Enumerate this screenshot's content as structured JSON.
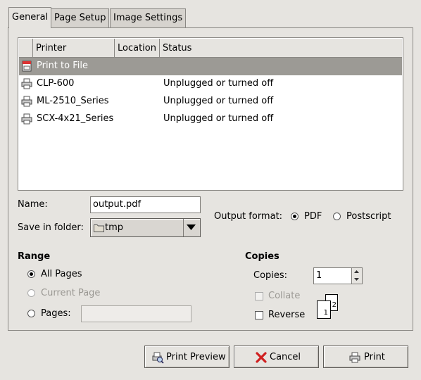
{
  "tabs": [
    {
      "label": "General",
      "active": true
    },
    {
      "label": "Page Setup"
    },
    {
      "label": "Image Settings"
    }
  ],
  "printer_list": {
    "columns": [
      "Printer",
      "Location",
      "Status"
    ],
    "rows": [
      {
        "name": "Print to File",
        "location": "",
        "status": "",
        "icon": "print-to-file-icon",
        "selected": true
      },
      {
        "name": "CLP-600",
        "location": "",
        "status": "Unplugged or turned off",
        "icon": "printer-icon"
      },
      {
        "name": "ML-2510_Series",
        "location": "",
        "status": "Unplugged or turned off",
        "icon": "printer-icon"
      },
      {
        "name": "SCX-4x21_Series",
        "location": "",
        "status": "Unplugged or turned off",
        "icon": "printer-icon"
      }
    ]
  },
  "file": {
    "name_label": "Name:",
    "name_value": "output.pdf",
    "folder_label": "Save in folder:",
    "folder_value": "tmp",
    "output_format_label": "Output format:",
    "format_pdf": "PDF",
    "format_ps": "Postscript",
    "selected_format": "PDF"
  },
  "range": {
    "heading": "Range",
    "all_pages": "All Pages",
    "current_page": "Current Page",
    "pages": "Pages:",
    "pages_value": ""
  },
  "copies": {
    "heading": "Copies",
    "copies_label": "Copies:",
    "copies_value": "1",
    "collate_label": "Collate",
    "reverse_label": "Reverse",
    "preview_page_front": "1",
    "preview_page_back": "2"
  },
  "buttons": {
    "preview": "Print Preview",
    "cancel": "Cancel",
    "print": "Print"
  }
}
